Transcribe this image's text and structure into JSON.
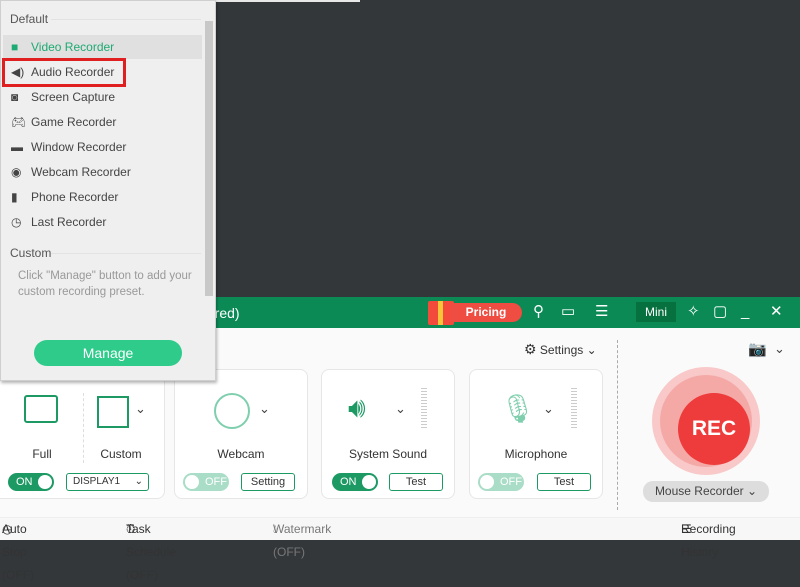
{
  "app": {
    "title_fragment": "tered)",
    "pricing": "Pricing",
    "mini": "Mini"
  },
  "toolbar": {
    "settings": "Settings"
  },
  "sources": {
    "full": "Full",
    "custom": "Custom",
    "display": "DISPLAY1",
    "display_toggle": "ON",
    "webcam": "Webcam",
    "webcam_toggle": "OFF",
    "webcam_btn": "Setting",
    "system_sound": "System Sound",
    "system_toggle": "ON",
    "system_btn": "Test",
    "microphone": "Microphone",
    "mic_toggle": "OFF",
    "mic_btn": "Test"
  },
  "rec": {
    "label": "REC",
    "mode": "Mouse Recorder"
  },
  "footer": {
    "auto_stop": "Auto Stop (OFF)",
    "task_schedule": "Task Schedule (OFF)",
    "watermark": "Watermark (OFF)",
    "history": "Recording History"
  },
  "popup": {
    "default_label": "Default",
    "items": [
      {
        "label": "Video Recorder",
        "icon": "video-icon"
      },
      {
        "label": "Audio Recorder",
        "icon": "speaker-icon"
      },
      {
        "label": "Screen Capture",
        "icon": "camera-icon"
      },
      {
        "label": "Game Recorder",
        "icon": "gamepad-icon"
      },
      {
        "label": "Window Recorder",
        "icon": "window-icon"
      },
      {
        "label": "Webcam Recorder",
        "icon": "webcam-icon"
      },
      {
        "label": "Phone Recorder",
        "icon": "phone-icon"
      },
      {
        "label": "Last Recorder",
        "icon": "clock-icon"
      }
    ],
    "custom_label": "Custom",
    "hint": "Click \"Manage\" button to add your custom recording preset.",
    "manage": "Manage"
  },
  "colors": {
    "accent": "#0c8a56",
    "rec": "#ee3b3b",
    "highlight": "#e02020"
  }
}
